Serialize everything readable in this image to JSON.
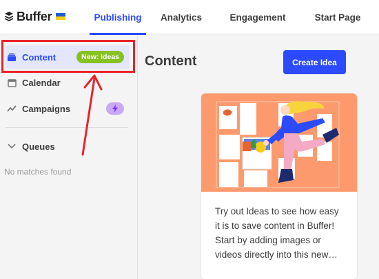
{
  "logo": {
    "text": "Buffer"
  },
  "nav": {
    "tabs": [
      {
        "label": "Publishing",
        "active": true
      },
      {
        "label": "Analytics",
        "active": false
      },
      {
        "label": "Engagement",
        "active": false
      },
      {
        "label": "Start Page",
        "active": false
      }
    ]
  },
  "sidebar": {
    "items": [
      {
        "label": "Content",
        "icon": "inbox-icon",
        "badge": "New: Ideas",
        "active": true
      },
      {
        "label": "Calendar",
        "icon": "calendar-icon"
      },
      {
        "label": "Campaigns",
        "icon": "trend-line-icon",
        "badge_icon": "lightning-bolt-icon"
      }
    ],
    "queues": {
      "label": "Queues",
      "icon": "chevron-down-icon"
    },
    "empty_text": "No matches found"
  },
  "main": {
    "title": "Content",
    "create_button": "Create Idea",
    "card": {
      "text": "Try out Ideas to see how easy\nit is to save content in Buffer!\nStart by adding images or\nvideos directly into this new…"
    }
  },
  "colors": {
    "accent": "#2c4bff",
    "badge_green": "#87c221",
    "badge_purple": "#c9a8f5",
    "illustration_bg": "#fd9a6d",
    "annotation_red": "#e8232b"
  }
}
